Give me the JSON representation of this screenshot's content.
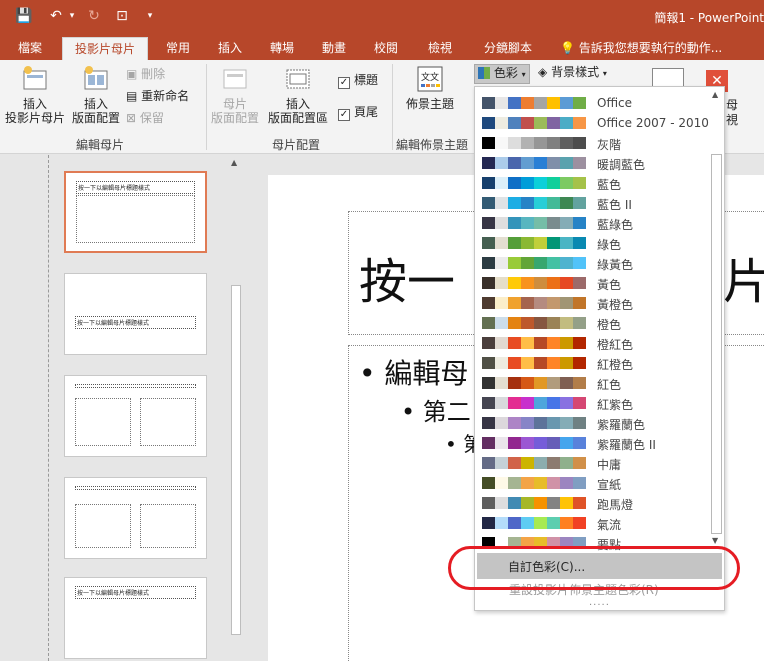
{
  "window": {
    "title": "簡報1 - PowerPoint"
  },
  "quick_access": {
    "save": "💾",
    "undo": "↶",
    "undo_menu": "▾",
    "redo": "↻",
    "present": "⊡",
    "customize": "▾"
  },
  "tabs": [
    "檔案",
    "投影片母片",
    "常用",
    "插入",
    "轉場",
    "動畫",
    "校閱",
    "檢視",
    "分鏡腳本"
  ],
  "tell_me": "告訴我您想要執行的動作...",
  "ribbon": {
    "insert_slide_master": "插入\n投影片母片",
    "insert_layout": "插入\n版面配置",
    "delete": "刪除",
    "rename": "重新命名",
    "preserve": "保留",
    "group_edit_master": "編輯母片",
    "master_layout": "母片\n版面配置",
    "insert_placeholder": "插入\n版面配置區",
    "title_check": "標題",
    "footer_check": "頁尾",
    "group_master_layout": "母片配置",
    "themes": "佈景主題",
    "group_edit_theme": "編輯佈景主題",
    "colors_btn": "色彩",
    "background_styles": "背景樣式",
    "close_master_partial": "母\n視",
    "theme_icon_text": "文文"
  },
  "thumbnails": [
    {
      "title": "按一下以編輯母片標題樣式"
    },
    {
      "title": "按一下以編輯母片標題樣式"
    },
    {
      "title": ""
    },
    {
      "title": ""
    },
    {
      "title": "按一下以編輯母片標題樣式"
    }
  ],
  "slide": {
    "title": "按一下以編輯母片標題樣式",
    "title_visible_start": "按一",
    "title_visible_end": "片",
    "level1": "• 編輯母",
    "level2": "• 第二",
    "level3": "• 第"
  },
  "color_menu": {
    "items": [
      {
        "label": "Office",
        "colors": [
          "#44546a",
          "#e7e6e6",
          "#4472c4",
          "#ed7d31",
          "#a5a5a5",
          "#ffc000",
          "#5b9bd5",
          "#70ad47"
        ]
      },
      {
        "label": "Office 2007 - 2010",
        "colors": [
          "#1f497d",
          "#eeece1",
          "#4f81bd",
          "#c0504d",
          "#9bbb59",
          "#8064a2",
          "#4bacc6",
          "#f79646"
        ]
      },
      {
        "label": "灰階",
        "colors": [
          "#000000",
          "#f8f8f8",
          "#dddddd",
          "#b2b2b2",
          "#969696",
          "#808080",
          "#5f5f5f",
          "#4d4d4d"
        ]
      },
      {
        "label": "暖調藍色",
        "colors": [
          "#242852",
          "#acccea",
          "#4a66ac",
          "#629dd1",
          "#297fd5",
          "#7f8fa9",
          "#5aa2ae",
          "#9d90a0"
        ]
      },
      {
        "label": "藍色",
        "colors": [
          "#17406d",
          "#dbeff9",
          "#0f6fc6",
          "#009dd9",
          "#0bd0d9",
          "#10cf9b",
          "#7cca62",
          "#a5c249"
        ]
      },
      {
        "label": "藍色 II",
        "colors": [
          "#335b74",
          "#dfe3e5",
          "#1cade4",
          "#2683c6",
          "#27ced7",
          "#42ba97",
          "#3e8853",
          "#62a39f"
        ]
      },
      {
        "label": "藍綠色",
        "colors": [
          "#373545",
          "#dedede",
          "#3494ba",
          "#58b6c0",
          "#75bda7",
          "#7a8c8e",
          "#84acb6",
          "#2683c6"
        ]
      },
      {
        "label": "綠色",
        "colors": [
          "#455f51",
          "#e3ded1",
          "#549e39",
          "#8ab833",
          "#c0cf3a",
          "#029676",
          "#4ab5c4",
          "#0989b1"
        ]
      },
      {
        "label": "綠黃色",
        "colors": [
          "#2c3c43",
          "#ebebeb",
          "#99cb38",
          "#63a537",
          "#37a76f",
          "#44c1a3",
          "#4eb3cf",
          "#51c3f9"
        ]
      },
      {
        "label": "黃色",
        "colors": [
          "#39302a",
          "#e5dec9",
          "#ffca08",
          "#f8931d",
          "#ce8d3e",
          "#ec7016",
          "#e64823",
          "#9c6a6a"
        ]
      },
      {
        "label": "黃橙色",
        "colors": [
          "#4e3b30",
          "#fbeec9",
          "#f0a22e",
          "#a5644e",
          "#b58b80",
          "#c3986d",
          "#a19574",
          "#c17529"
        ]
      },
      {
        "label": "橙色",
        "colors": [
          "#637052",
          "#ccddea",
          "#e48312",
          "#bd582c",
          "#865640",
          "#9b8357",
          "#c2bc80",
          "#94a088"
        ]
      },
      {
        "label": "橙紅色",
        "colors": [
          "#4a3e3c",
          "#e1d9d1",
          "#e84c22",
          "#ffbd47",
          "#b64926",
          "#ff8427",
          "#cc9900",
          "#b22600"
        ]
      },
      {
        "label": "紅橙色",
        "colors": [
          "#505046",
          "#eeece1",
          "#e84c22",
          "#ffbd47",
          "#b64926",
          "#ff8427",
          "#cc9900",
          "#b22600"
        ]
      },
      {
        "label": "紅色",
        "colors": [
          "#323232",
          "#e3ded1",
          "#a5300f",
          "#d55816",
          "#e19825",
          "#b19c7d",
          "#7f5f52",
          "#b27d49"
        ]
      },
      {
        "label": "紅紫色",
        "colors": [
          "#454551",
          "#d8d9dc",
          "#e32d91",
          "#c830cc",
          "#4ea6dc",
          "#4775e7",
          "#8971e1",
          "#d54773"
        ]
      },
      {
        "label": "紫羅蘭色",
        "colors": [
          "#373545",
          "#dcd8dc",
          "#ad84c6",
          "#8784c7",
          "#5d739a",
          "#6997af",
          "#84acb6",
          "#6f8183"
        ]
      },
      {
        "label": "紫羅蘭色 II",
        "colors": [
          "#632e62",
          "#eae5eb",
          "#92278f",
          "#9b57d3",
          "#755dd9",
          "#665eb8",
          "#45a5ed",
          "#5982db"
        ]
      },
      {
        "label": "中庸",
        "colors": [
          "#646b86",
          "#c5d1d7",
          "#d16349",
          "#ccb400",
          "#8cadae",
          "#8c7b70",
          "#8fb08c",
          "#d19049"
        ]
      },
      {
        "label": "宣紙",
        "colors": [
          "#444d26",
          "#fef9e7",
          "#a5b592",
          "#f3a447",
          "#e7bc29",
          "#d092a7",
          "#9c85c0",
          "#809ec2"
        ]
      },
      {
        "label": "跑馬燈",
        "colors": [
          "#5e5e5e",
          "#ddddde",
          "#418ab3",
          "#a6b727",
          "#f69200",
          "#838383",
          "#fec306",
          "#df5327"
        ]
      },
      {
        "label": "氣流",
        "colors": [
          "#212745",
          "#b4dcfa",
          "#4e67c8",
          "#5eccf3",
          "#a7ea52",
          "#5dceaf",
          "#ff8021",
          "#f14124"
        ]
      },
      {
        "label": "要點",
        "colors": [
          "#000000",
          "#ffffff",
          "#a5b592",
          "#f3a447",
          "#e7bc29",
          "#d092a7",
          "#9c85c0",
          "#809ec2"
        ]
      }
    ],
    "custom_colors": "自訂色彩(C)...",
    "reset_theme": "重設投影片佈景主題色彩(R)",
    "grip": "....."
  }
}
